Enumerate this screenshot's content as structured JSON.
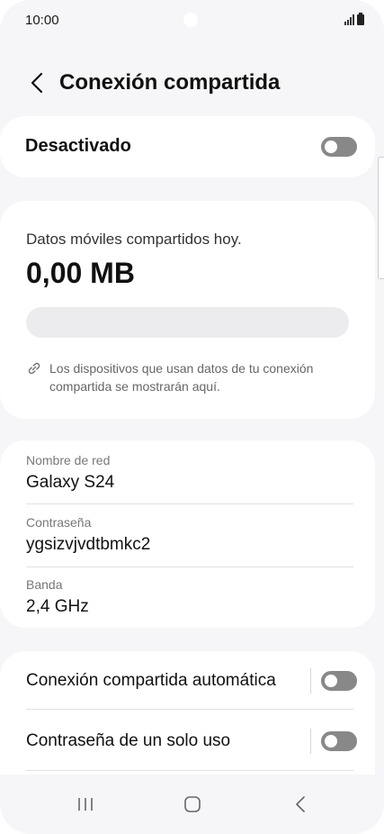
{
  "status_bar": {
    "time": "10:00"
  },
  "header": {
    "title": "Conexión compartida"
  },
  "master_switch": {
    "label": "Desactivado",
    "on": false
  },
  "usage": {
    "label": "Datos móviles compartidos hoy.",
    "value": "0,00 MB",
    "usage_fraction": 0,
    "info": "Los dispositivos que usan datos de tu conexión compartida se mostrarán aquí."
  },
  "network": {
    "name_label": "Nombre de red",
    "name_value": "Galaxy S24",
    "password_label": "Contraseña",
    "password_value": "ygsizvjvdtbmkc2",
    "band_label": "Banda",
    "band_value": "2,4 GHz"
  },
  "settings": {
    "auto_hotspot_label": "Conexión compartida automática",
    "auto_hotspot_on": false,
    "one_time_password_label": "Contraseña de un solo uso",
    "one_time_password_on": false
  },
  "colors": {
    "background": "#f6f6f8",
    "card": "#ffffff",
    "toggle_off": "#888888",
    "accent": "#3e91ff"
  },
  "icons": [
    "back-icon",
    "link-icon",
    "recent-apps-icon",
    "home-icon",
    "back-nav-icon",
    "signal-icon",
    "battery-icon"
  ]
}
